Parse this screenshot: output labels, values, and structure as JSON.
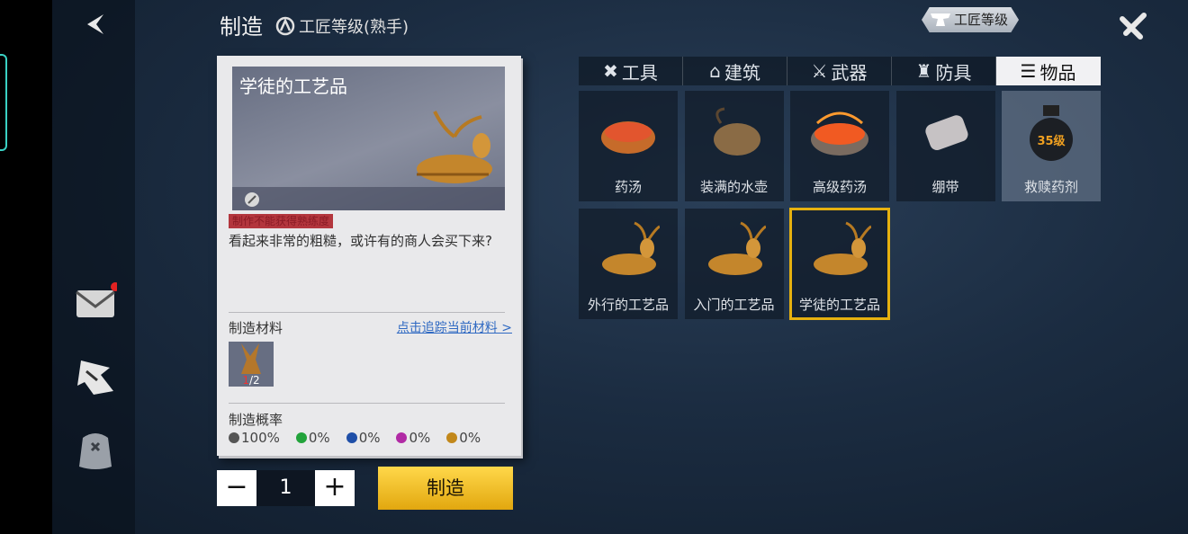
{
  "header": {
    "title": "制造",
    "level_text": "工匠等级(熟手)",
    "badge": "工匠等级"
  },
  "sidebar": {
    "mail_icon": "mail-icon",
    "craft_icon": "craft-icon",
    "bag_icon": "backpack-icon"
  },
  "item": {
    "name": "学徒的工艺品",
    "warning": "制作不能获得熟练度",
    "description": "看起来非常的粗糙，或许有的商人会买下来?",
    "materials_label": "制造材料",
    "track_link": "点击追踪当前材料 >",
    "material": {
      "have": "1",
      "need": "/2"
    },
    "rate_label": "制造概率",
    "rates": [
      {
        "value": "100%",
        "color": "#555555"
      },
      {
        "value": "0%",
        "color": "#22a33b"
      },
      {
        "value": "0%",
        "color": "#1f4fa8"
      },
      {
        "value": "0%",
        "color": "#b12aa5"
      },
      {
        "value": "0%",
        "color": "#c2881b"
      }
    ]
  },
  "quantity": {
    "minus": "−",
    "value": "1",
    "plus": "+"
  },
  "make_button": "制造",
  "tabs": [
    {
      "label": "工具",
      "icon": "tools-icon"
    },
    {
      "label": "建筑",
      "icon": "building-icon"
    },
    {
      "label": "武器",
      "icon": "weapon-icon"
    },
    {
      "label": "防具",
      "icon": "armor-icon"
    },
    {
      "label": "物品",
      "icon": "list-icon",
      "active": true
    }
  ],
  "items": [
    {
      "name": "药汤",
      "icon": "soup-icon"
    },
    {
      "name": "装满的水壶",
      "icon": "water-flask-icon"
    },
    {
      "name": "高级药汤",
      "icon": "advanced-soup-icon"
    },
    {
      "name": "绷带",
      "icon": "bandage-icon"
    },
    {
      "name": "救赎药剂",
      "icon": "potion-icon",
      "badge": "35级"
    },
    {
      "name": "外行的工艺品",
      "icon": "deer-figurine-icon"
    },
    {
      "name": "入门的工艺品",
      "icon": "deer-figurine-icon"
    },
    {
      "name": "学徒的工艺品",
      "icon": "deer-figurine-icon",
      "selected": true
    }
  ]
}
